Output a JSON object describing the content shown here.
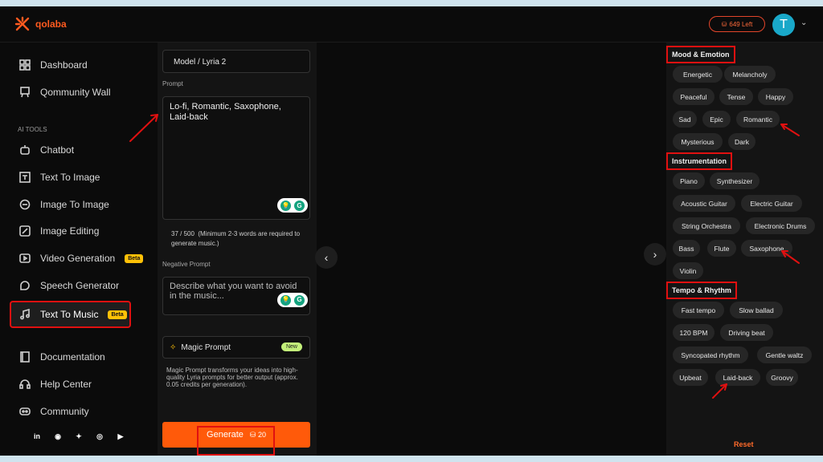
{
  "brand": {
    "name": "qolaba",
    "accent": "#ff5a1f"
  },
  "header": {
    "credits_label": "649 Left",
    "avatar_initial": "T"
  },
  "sidebar": {
    "items_top": [
      {
        "label": "Dashboard",
        "icon": "grid-icon"
      },
      {
        "label": "Qommunity Wall",
        "icon": "board-icon"
      }
    ],
    "section_label": "AI TOOLS",
    "tools": [
      {
        "label": "Chatbot",
        "icon": "robot-icon"
      },
      {
        "label": "Text To Image",
        "icon": "image-text-icon"
      },
      {
        "label": "Image To Image",
        "icon": "image-swap-icon"
      },
      {
        "label": "Image Editing",
        "icon": "edit-icon"
      },
      {
        "label": "Video Generation",
        "icon": "video-icon",
        "badge": "Beta"
      },
      {
        "label": "Speech Generator",
        "icon": "speech-icon"
      },
      {
        "label": "Text To Music",
        "icon": "music-icon",
        "badge": "Beta",
        "active": true
      }
    ],
    "items_bottom": [
      {
        "label": "Documentation",
        "icon": "book-icon"
      },
      {
        "label": "Help Center",
        "icon": "headset-icon"
      },
      {
        "label": "Community",
        "icon": "discord-icon"
      }
    ],
    "socials": [
      "linkedin-icon",
      "discord-icon",
      "twitter-icon",
      "instagram-icon",
      "youtube-icon"
    ]
  },
  "form": {
    "model_value": "Model / Lyria 2",
    "prompt_label": "Prompt",
    "prompt_value": "Lo-fi, Romantic, Saxophone, Laid-back",
    "char_count": "37 / 500",
    "count_hint": "(Minimum 2-3 words are required to generate music.)",
    "negative_label": "Negative Prompt",
    "negative_placeholder": "Describe what you want to avoid in the music...",
    "magic_label": "Magic Prompt",
    "magic_badge": "New",
    "magic_desc": "Magic Prompt transforms your ideas into high-quality Lyria prompts for better output (approx. 0.05 credits per generation).",
    "generate_label": "Generate",
    "generate_cost": "20"
  },
  "panel": {
    "mood_title": "Mood & Emotion",
    "mood": [
      "Energetic",
      "Melancholy",
      "Peaceful",
      "Tense",
      "Happy",
      "Sad",
      "Epic",
      "Romantic",
      "Mysterious",
      "Dark"
    ],
    "instr_title": "Instrumentation",
    "instr": [
      "Piano",
      "Synthesizer",
      "Acoustic Guitar",
      "Electric Guitar",
      "String Orchestra",
      "Electronic Drums",
      "Bass",
      "Flute",
      "Saxophone",
      "Violin"
    ],
    "tempo_title": "Tempo & Rhythm",
    "tempo": [
      "Fast tempo",
      "Slow ballad",
      "120 BPM",
      "Driving beat",
      "Syncopated rhythm",
      "Gentle waltz",
      "Upbeat",
      "Laid-back",
      "Groovy"
    ],
    "reset_label": "Reset"
  }
}
